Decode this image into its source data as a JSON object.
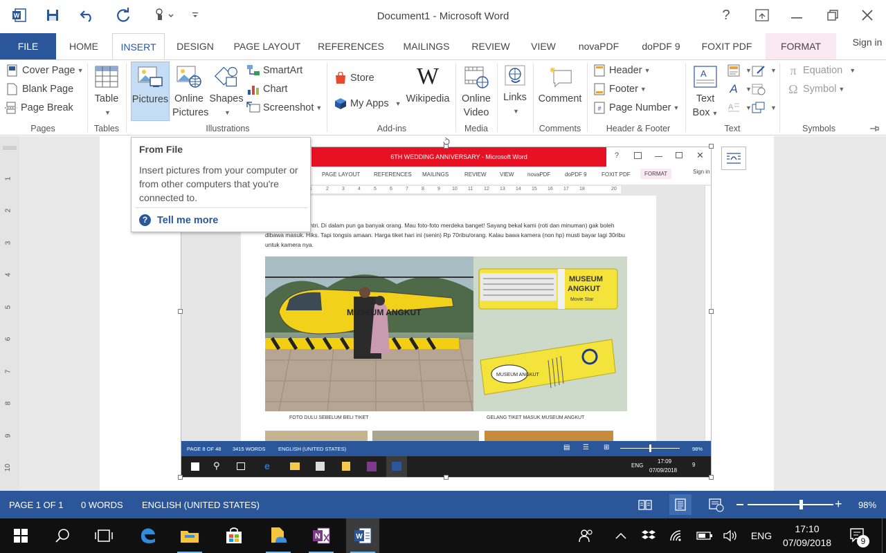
{
  "window": {
    "title": "Document1 - Microsoft Word",
    "sign_in": "Sign in",
    "help": "?"
  },
  "tabs": [
    {
      "label": "FILE"
    },
    {
      "label": "HOME"
    },
    {
      "label": "INSERT"
    },
    {
      "label": "DESIGN"
    },
    {
      "label": "PAGE LAYOUT"
    },
    {
      "label": "REFERENCES"
    },
    {
      "label": "MAILINGS"
    },
    {
      "label": "REVIEW"
    },
    {
      "label": "VIEW"
    },
    {
      "label": "novaPDF"
    },
    {
      "label": "doPDF 9"
    },
    {
      "label": "FOXIT PDF"
    },
    {
      "label": "FORMAT"
    }
  ],
  "ribbon": {
    "pages": {
      "cover_page": "Cover Page",
      "blank_page": "Blank Page",
      "page_break": "Page Break",
      "label": "Pages"
    },
    "tables": {
      "table": "Table",
      "label": "Tables"
    },
    "illustrations": {
      "pictures": "Pictures",
      "online_pictures_1": "Online",
      "online_pictures_2": "Pictures",
      "shapes": "Shapes",
      "smartart": "SmartArt",
      "chart": "Chart",
      "screenshot": "Screenshot",
      "label": "Illustrations"
    },
    "addins": {
      "store": "Store",
      "my_apps": "My Apps",
      "wikipedia": "Wikipedia",
      "label": "Add-ins"
    },
    "media": {
      "online_video_1": "Online",
      "online_video_2": "Video",
      "label": "Media"
    },
    "links": {
      "links": "Links"
    },
    "comments": {
      "comment": "Comment",
      "label": "Comments"
    },
    "header_footer": {
      "header": "Header",
      "footer": "Footer",
      "page_number": "Page Number",
      "label": "Header & Footer"
    },
    "text": {
      "text_box_1": "Text",
      "text_box_2": "Box",
      "label": "Text"
    },
    "symbols": {
      "equation": "Equation",
      "symbol": "Symbol",
      "label": "Symbols"
    }
  },
  "tooltip": {
    "title": "From File",
    "body": "Insert pictures from your computer or from other computers that you're connected to.",
    "help_link": "Tell me more"
  },
  "ruler_numbers": [
    "1",
    "2",
    "3",
    "4",
    "5",
    "6",
    "7",
    "8",
    "9",
    "10"
  ],
  "embedded": {
    "title": "6TH WEDDING ANNIVERSARY -  Microsoft Word",
    "help": "?",
    "tabs": [
      "PAGE LAYOUT",
      "REFERENCES",
      "MAILINGS",
      "REVIEW",
      "VIEW",
      "novaPDF",
      "doPDF 9",
      "FOXIT PDF",
      "FORMAT"
    ],
    "sign_in": "Sign in",
    "ruler": [
      "1",
      "2",
      "3",
      "4",
      "5",
      "6",
      "7",
      "8",
      "9",
      "10",
      "11",
      "12",
      "13",
      "14",
      "15",
      "16",
      "17",
      "18",
      "20"
    ],
    "paragraph": "beli tiket engga antri. Di dalam pun ga banyak orang. Mau foto-foto merdeka banget! Sayang bekal kami (roti dan minuman) gak boleh dibawa masuk. Hiks. Tapi tongsis amaan. Harga tiket hari ini (senin) Rp 70ribu/orang. Kalau bawa kamera (non hp) musti bayar lagi 30ribu untuk kamera nya.",
    "caption_left": "FOTO DULU SEBELUM BELI TIKET",
    "caption_right": "GELANG TIKET MASUK MUSEUM ANGKUT",
    "museum_text": "MUSEUM ANGKUT",
    "status": {
      "page": "PAGE 8 OF 48",
      "words": "3415 WORDS",
      "language": "ENGLISH (UNITED STATES)",
      "zoom": "98%"
    },
    "taskbar": {
      "lang": "ENG",
      "time": "17:09",
      "date": "07/09/2018",
      "badge": "9"
    }
  },
  "status": {
    "page": "PAGE 1 OF 1",
    "words": "0 WORDS",
    "language": "ENGLISH (UNITED STATES)",
    "zoom": "98%",
    "zoom_level": 0.62
  },
  "taskbar": {
    "lang": "ENG",
    "time": "17:10",
    "date": "07/09/2018",
    "notif_count": "9"
  },
  "colors": {
    "word_blue": "#2b579a",
    "title_red": "#e81123",
    "format_tab_pink": "#fbe9f2",
    "taskbar": "#101010"
  }
}
